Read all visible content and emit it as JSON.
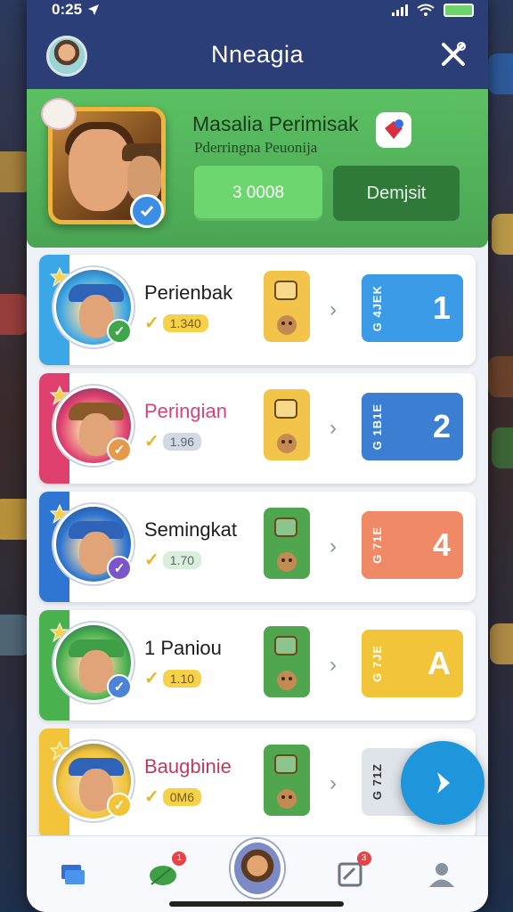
{
  "status_bar": {
    "time": "0:25"
  },
  "header": {
    "title": "Nneagia",
    "avatar_icon": "user-avatar",
    "tools_icon": "tools-icon"
  },
  "hero": {
    "name": "Masalia Perimisak",
    "subtitle": "Pderringna Peuonija",
    "amount_button": "3 0008",
    "deposit_button": "Demjsit",
    "colors": {
      "bg": "#5cc163",
      "amount_btn": "#6ed66e",
      "deposit_btn": "#2f7a39"
    }
  },
  "rows": [
    {
      "name": "Perienbak",
      "score": "1.340",
      "code": "G 4JEK",
      "rank": "1",
      "accent": "#3ba7e6",
      "rank_color": "#3c9be6",
      "item_color": "#f2c54a",
      "name_color": "#1e1e1e",
      "pill_color": "#f5d24a",
      "badge_color": "#3fa64a"
    },
    {
      "name": "Peringian",
      "score": "1.96",
      "code": "G 1B1E",
      "rank": "2",
      "accent": "#e0406e",
      "rank_color": "#3c7ed1",
      "item_color": "#f2c54a",
      "name_color": "#d2457a",
      "pill_color": "#d3d9e2",
      "badge_color": "#e59a4b"
    },
    {
      "name": "Semingkat",
      "score": "1.70",
      "code": "G 71E",
      "rank": "4",
      "accent": "#2e76d2",
      "rank_color": "#f08a66",
      "item_color": "#4fa64f",
      "name_color": "#1e1e1e",
      "pill_color": "#d9eedb",
      "badge_color": "#7a56c8"
    },
    {
      "name": "1 Paniou",
      "score": "1.10",
      "code": "G 7JE",
      "rank": "A",
      "accent": "#49b24f",
      "rank_color": "#f2c43a",
      "item_color": "#4fa64f",
      "name_color": "#1e1e1e",
      "pill_color": "#f5d24a",
      "badge_color": "#4b83d6"
    },
    {
      "name": "Baugbinie",
      "score": "0M6",
      "code": "G 71Z",
      "rank": "",
      "accent": "#f2c43a",
      "rank_color": "#dfe4ea",
      "item_color": "#4fa64f",
      "name_color": "#c23a5a",
      "pill_color": "#f5d24a",
      "badge_color": "#f2c43a"
    }
  ],
  "fab_icon": "next-arrow-icon",
  "tabbar": {
    "tabs": [
      {
        "icon": "cards-icon"
      },
      {
        "icon": "leaf-icon",
        "badge": "1"
      },
      {
        "icon": "profile-center-icon"
      },
      {
        "icon": "notes-icon",
        "badge": "3"
      },
      {
        "icon": "person-icon"
      }
    ]
  }
}
